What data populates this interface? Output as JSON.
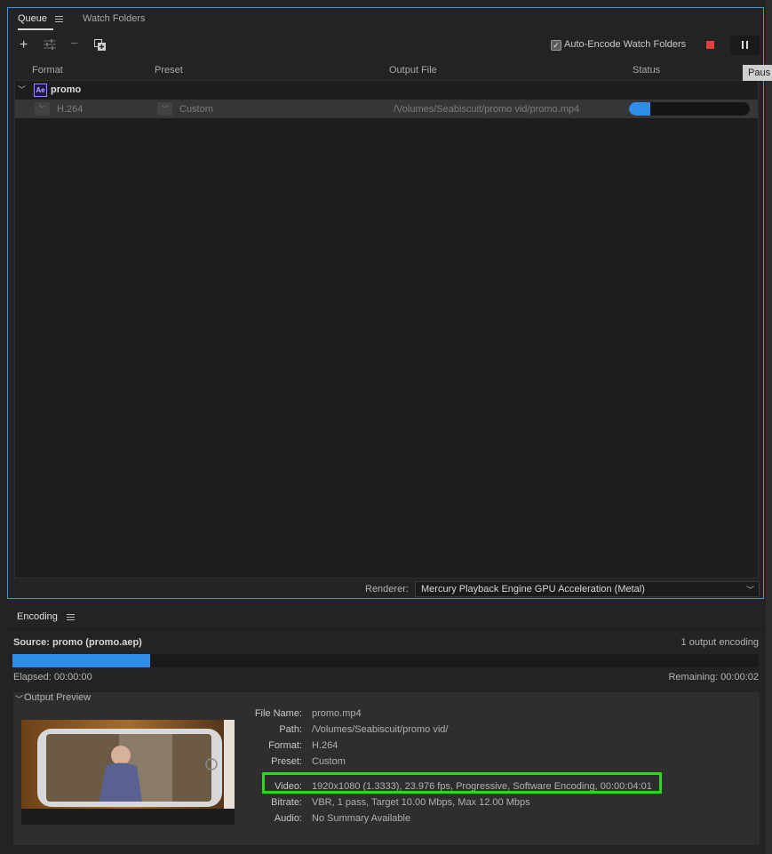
{
  "queue_panel": {
    "tabs": [
      {
        "label": "Queue"
      },
      {
        "label": "Watch Folders"
      }
    ],
    "toolbar": {
      "add_icon": "plus-icon",
      "settings_icon": "sliders-icon",
      "remove_icon": "minus-icon",
      "duplicate_icon": "duplicate-icon",
      "auto_encode_label": "Auto-Encode Watch Folders",
      "auto_encode_checked": true
    },
    "columns": {
      "format": "Format",
      "preset": "Preset",
      "output_file": "Output File",
      "status": "Status"
    },
    "group": {
      "badge": "Ae",
      "name": "promo"
    },
    "item": {
      "format": "H.264",
      "preset": "Custom",
      "output_file": "/Volumes/Seabiscuit/promo vid/promo.mp4",
      "progress": 0.18
    },
    "renderer": {
      "label": "Renderer:",
      "value": "Mercury Playback Engine GPU Acceleration (Metal)"
    }
  },
  "tooltip": "Paus",
  "encoding_panel": {
    "title": "Encoding",
    "source": "Source: promo (promo.aep)",
    "outputs_count": "1 output encoding",
    "progress": 0.185,
    "elapsed": "Elapsed: 00:00:00",
    "remaining": "Remaining: 00:00:02",
    "preview_header": "Output Preview",
    "details": {
      "file_name_label": "File Name:",
      "file_name": "promo.mp4",
      "path_label": "Path:",
      "path": "/Volumes/Seabiscuit/promo vid/",
      "format_label": "Format:",
      "format": "H.264",
      "preset_label": "Preset:",
      "preset": "Custom",
      "video_label": "Video:",
      "video": "1920x1080 (1.3333), 23.976 fps, Progressive, Software Encoding, 00:00:04:01",
      "bitrate_label": "Bitrate:",
      "bitrate": "VBR, 1 pass, Target 10.00 Mbps, Max 12.00 Mbps",
      "audio_label": "Audio:",
      "audio": "No Summary Available"
    }
  },
  "colors": {
    "accent_blue": "#2f8ce8",
    "stop_red": "#e2413b",
    "highlight_green": "#2fd621"
  }
}
